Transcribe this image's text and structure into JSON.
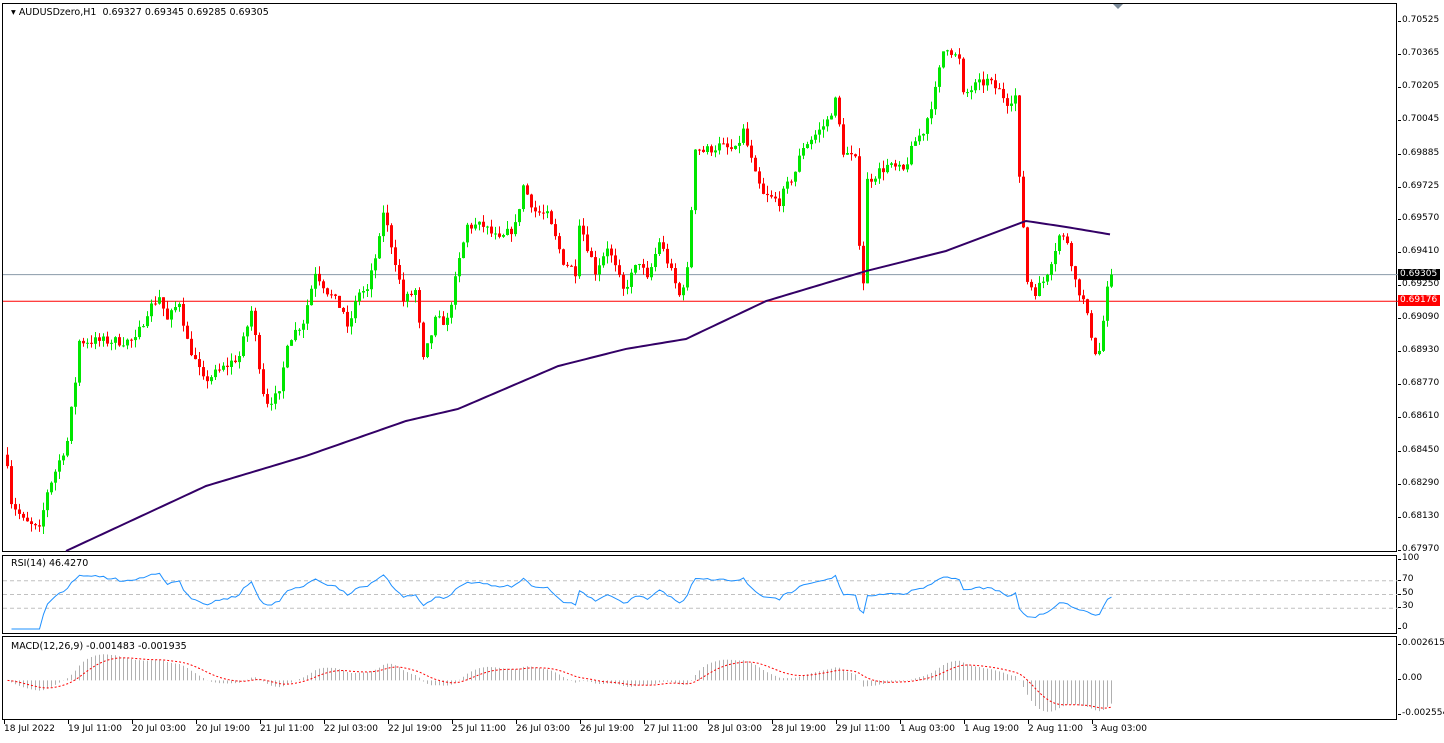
{
  "header": {
    "symbol": "AUDUSDzero,H1",
    "open": "0.69327",
    "high": "0.69345",
    "low": "0.69285",
    "close": "0.69305"
  },
  "price_axis": [
    "0.70525",
    "0.70365",
    "0.70205",
    "0.70045",
    "0.69885",
    "0.69725",
    "0.69570",
    "0.69410",
    "0.69250",
    "0.69090",
    "0.68930",
    "0.68770",
    "0.68610",
    "0.68450",
    "0.68290",
    "0.68130",
    "0.67970"
  ],
  "price_range": [
    0.6797,
    0.70525
  ],
  "bid_line": {
    "label": "0.69305",
    "value": 0.69305,
    "color": "#000000"
  },
  "level_line": {
    "label": "0.69176",
    "value": 0.69176,
    "color": "#ff0000"
  },
  "time_axis": [
    "18 Jul 2022",
    "19 Jul 11:00",
    "20 Jul 03:00",
    "20 Jul 19:00",
    "21 Jul 11:00",
    "22 Jul 03:00",
    "22 Jul 19:00",
    "25 Jul 11:00",
    "26 Jul 03:00",
    "26 Jul 19:00",
    "27 Jul 11:00",
    "28 Jul 03:00",
    "28 Jul 19:00",
    "29 Jul 11:00",
    "1 Aug 03:00",
    "1 Aug 19:00",
    "2 Aug 11:00",
    "3 Aug 03:00"
  ],
  "rsi": {
    "label": "RSI(14) 46.4270",
    "axis": [
      "100",
      "70",
      "50",
      "30",
      "0"
    ],
    "color": "#1e90ff"
  },
  "macd": {
    "label": "MACD(12,26,9) -0.001483 -0.001935",
    "axis": [
      "0.002615",
      "0.00",
      "-0.002554"
    ],
    "range": [
      -0.002554,
      0.002615
    ]
  },
  "colors": {
    "bull": "#00e600",
    "bear": "#ff0000",
    "ma": "#330066"
  },
  "chart_data": {
    "type": "candlestick",
    "candle_count": 277,
    "close_keypoints": [
      [
        1,
        0.68405
      ],
      [
        2,
        0.68211
      ],
      [
        5,
        0.68115
      ],
      [
        9,
        0.68067
      ],
      [
        11,
        0.6826
      ],
      [
        14,
        0.68405
      ],
      [
        16,
        0.68501
      ],
      [
        18,
        0.68791
      ],
      [
        19,
        0.68984
      ],
      [
        23,
        0.68984
      ],
      [
        28,
        0.68984
      ],
      [
        33,
        0.68984
      ],
      [
        36,
        0.69129
      ],
      [
        39,
        0.69202
      ],
      [
        41,
        0.69081
      ],
      [
        44,
        0.69177
      ],
      [
        46,
        0.68984
      ],
      [
        50,
        0.68791
      ],
      [
        54,
        0.68839
      ],
      [
        59,
        0.68912
      ],
      [
        62,
        0.69129
      ],
      [
        65,
        0.68743
      ],
      [
        66,
        0.68694
      ],
      [
        69,
        0.68719
      ],
      [
        71,
        0.68984
      ],
      [
        75,
        0.69081
      ],
      [
        78,
        0.69322
      ],
      [
        81,
        0.69226
      ],
      [
        85,
        0.69129
      ],
      [
        86,
        0.69033
      ],
      [
        89,
        0.69226
      ],
      [
        91,
        0.69226
      ],
      [
        94,
        0.69467
      ],
      [
        95,
        0.69612
      ],
      [
        98,
        0.69371
      ],
      [
        100,
        0.69177
      ],
      [
        103,
        0.69226
      ],
      [
        105,
        0.68888
      ],
      [
        108,
        0.69081
      ],
      [
        111,
        0.69081
      ],
      [
        114,
        0.69371
      ],
      [
        116,
        0.6954
      ],
      [
        120,
        0.6954
      ],
      [
        124,
        0.69467
      ],
      [
        128,
        0.6954
      ],
      [
        130,
        0.69733
      ],
      [
        133,
        0.69612
      ],
      [
        136,
        0.69588
      ],
      [
        140,
        0.69371
      ],
      [
        143,
        0.69322
      ],
      [
        144,
        0.69564
      ],
      [
        148,
        0.69322
      ],
      [
        151,
        0.69443
      ],
      [
        155,
        0.69226
      ],
      [
        159,
        0.69371
      ],
      [
        161,
        0.69274
      ],
      [
        164,
        0.69467
      ],
      [
        166,
        0.69371
      ],
      [
        169,
        0.69202
      ],
      [
        171,
        0.69322
      ],
      [
        173,
        0.69926
      ],
      [
        175,
        0.69902
      ],
      [
        179,
        0.69926
      ],
      [
        183,
        0.69902
      ],
      [
        185,
        0.69999
      ],
      [
        188,
        0.69781
      ],
      [
        190,
        0.69685
      ],
      [
        194,
        0.6966
      ],
      [
        198,
        0.69805
      ],
      [
        200,
        0.69926
      ],
      [
        204,
        0.69999
      ],
      [
        206,
        0.70047
      ],
      [
        208,
        0.70143
      ],
      [
        210,
        0.69902
      ],
      [
        213,
        0.69854
      ],
      [
        214,
        0.69467
      ],
      [
        215,
        0.69274
      ],
      [
        216,
        0.69757
      ],
      [
        219,
        0.69805
      ],
      [
        221,
        0.69829
      ],
      [
        225,
        0.69805
      ],
      [
        228,
        0.6995
      ],
      [
        230,
        0.69999
      ],
      [
        233,
        0.70192
      ],
      [
        235,
        0.70385
      ],
      [
        236,
        0.70409
      ],
      [
        239,
        0.70337
      ],
      [
        240,
        0.70168
      ],
      [
        243,
        0.70216
      ],
      [
        246,
        0.7024
      ],
      [
        249,
        0.70192
      ],
      [
        251,
        0.70143
      ],
      [
        253,
        0.70168
      ],
      [
        254,
        0.69757
      ],
      [
        255,
        0.6954
      ],
      [
        256,
        0.69274
      ],
      [
        258,
        0.69226
      ],
      [
        260,
        0.69274
      ],
      [
        261,
        0.69322
      ],
      [
        264,
        0.69491
      ],
      [
        266,
        0.69467
      ],
      [
        268,
        0.69274
      ],
      [
        270,
        0.69177
      ],
      [
        273,
        0.68936
      ],
      [
        274,
        0.68936
      ],
      [
        276,
        0.69226
      ],
      [
        277,
        0.69305
      ]
    ],
    "ma_keypoints": [
      [
        15,
        0.6797
      ],
      [
        50,
        0.68284
      ],
      [
        75,
        0.68429
      ],
      [
        100,
        0.68598
      ],
      [
        113,
        0.68656
      ],
      [
        138,
        0.68863
      ],
      [
        155,
        0.68946
      ],
      [
        170,
        0.68994
      ],
      [
        190,
        0.69177
      ],
      [
        215,
        0.69322
      ],
      [
        235,
        0.69419
      ],
      [
        255,
        0.69564
      ],
      [
        265,
        0.69535
      ],
      [
        277,
        0.69496
      ]
    ],
    "rsi_levels": [
      70,
      50,
      30
    ],
    "macd_params": [
      12,
      26,
      9
    ]
  }
}
